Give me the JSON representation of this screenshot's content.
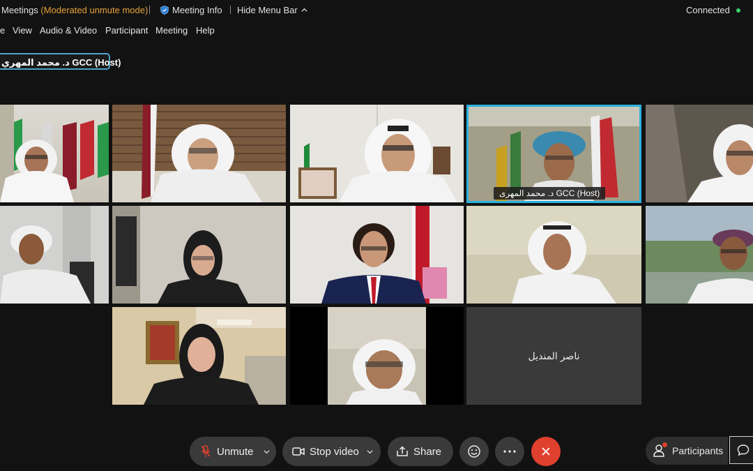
{
  "titlebar": {
    "app_name": "Meetings",
    "mode": "(Moderated unmute mode)",
    "meeting_info": "Meeting Info",
    "hide_menu_bar": "Hide Menu Bar",
    "status": "Connected"
  },
  "menu": {
    "items": [
      {
        "label": "e"
      },
      {
        "label": "View"
      },
      {
        "label": "Audio & Video"
      },
      {
        "label": "Participant"
      },
      {
        "label": "Meeting"
      },
      {
        "label": "Help"
      }
    ]
  },
  "speaker_label": "د. محمد المهري GCC (Host)",
  "tiles": [
    {
      "name": ""
    },
    {
      "name": ""
    },
    {
      "name": ""
    },
    {
      "name": "د. محمد المهرى GCC  (Host)"
    },
    {
      "name": ""
    },
    {
      "name": ""
    },
    {
      "name": ""
    },
    {
      "name": ""
    },
    {
      "name": ""
    },
    {
      "name": ""
    },
    {
      "name": ""
    },
    {
      "name": ""
    },
    {
      "name": "ناصر المنديل"
    }
  ],
  "controls": {
    "unmute": "Unmute",
    "stop_video": "Stop video",
    "share": "Share",
    "participants": "Participants"
  },
  "icons": {
    "mic": "mic-muted-icon",
    "video": "video-camera-icon",
    "share": "share-upload-icon",
    "reactions": "emoji-icon",
    "more": "more-dots-icon",
    "end": "close-x-icon",
    "participants": "person-icon",
    "chat": "chat-bubble-icon"
  },
  "colors": {
    "background": "#121212",
    "moderated_text": "#e8a23a",
    "active_border": "#2bb1de",
    "end_button": "#e0402e",
    "connected_dot": "#3ad06a"
  }
}
